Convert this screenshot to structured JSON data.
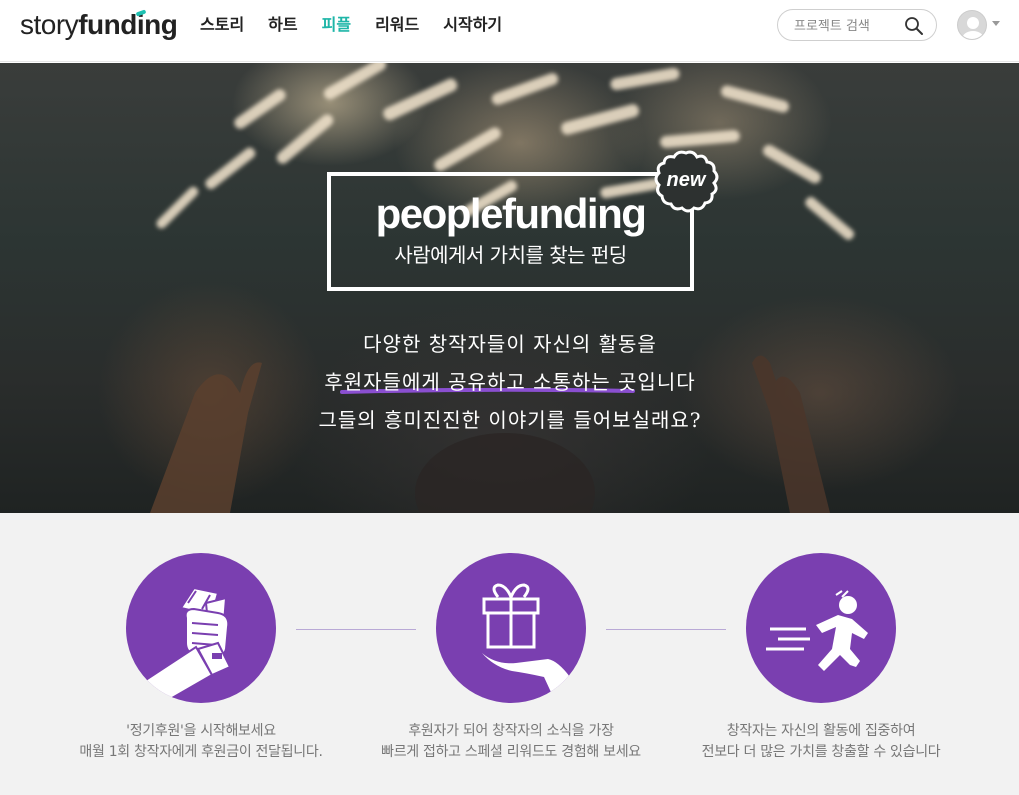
{
  "header": {
    "logo_light": "story",
    "logo_bold": "funding",
    "nav": [
      {
        "label": "스토리",
        "active": false
      },
      {
        "label": "하트",
        "active": false
      },
      {
        "label": "피플",
        "active": true
      },
      {
        "label": "리워드",
        "active": false
      },
      {
        "label": "시작하기",
        "active": false
      }
    ],
    "search_placeholder": "프로젝트 검색"
  },
  "hero": {
    "title": "peoplefunding",
    "subtitle": "사람에게서 가치를 찾는 펀딩",
    "badge": "new",
    "lines": [
      "다양한 창작자들이 자신의 활동을",
      "후원자들에게 공유하고 소통하는 곳입니다",
      "그들의 흥미진진한 이야기를 들어보실래요?"
    ]
  },
  "steps": [
    {
      "icon": "hand-money-icon",
      "caption_1": "'정기후원'을 시작해보세요",
      "caption_2": "매월 1회 창작자에게 후원금이 전달됩니다."
    },
    {
      "icon": "gift-hand-icon",
      "caption_1": "후원자가 되어 창작자의 소식을 가장",
      "caption_2": "빠르게 접하고 스페셜 리워드도 경험해 보세요"
    },
    {
      "icon": "running-person-icon",
      "caption_1": "창작자는 자신의 활동에 집중하여",
      "caption_2": "전보다 더 많은 가치를 창출할 수 있습니다"
    }
  ],
  "colors": {
    "accent": "#1fb6a8",
    "purple": "#7a3fb0"
  }
}
